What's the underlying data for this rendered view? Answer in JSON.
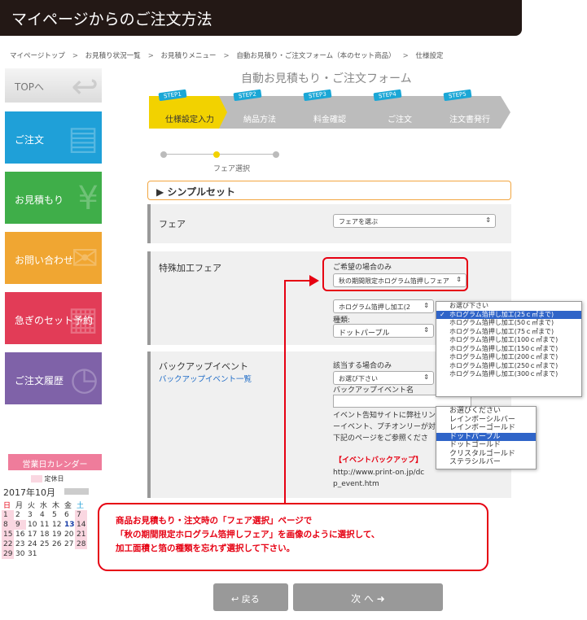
{
  "header": {
    "title": "マイページからのご注文方法"
  },
  "breadcrumb": [
    "マイページトップ",
    "お見積り状況一覧",
    "お見積りメニュー",
    "自動お見積り・ご注文フォーム（本のセット商品）",
    "仕様設定"
  ],
  "breadcrumb_sep": ">",
  "sidebar": {
    "top_label": "TOPへ",
    "items": [
      {
        "label": "ご注文",
        "color": "#1fa0d8"
      },
      {
        "label": "お見積もり",
        "color": "#3fae49"
      },
      {
        "label": "お問い合わせ",
        "color": "#f0a632"
      },
      {
        "label": "急ぎのセット予約",
        "color": "#e23c57"
      },
      {
        "label": "ご注文履歴",
        "color": "#7f62a8"
      }
    ]
  },
  "form_title": "自動お見積もり・ご注文フォーム",
  "steps": [
    {
      "tag": "STEP1",
      "label": "仕様設定入力"
    },
    {
      "tag": "STEP2",
      "label": "納品方法"
    },
    {
      "tag": "STEP3",
      "label": "料金確認"
    },
    {
      "tag": "STEP4",
      "label": "ご注文"
    },
    {
      "tag": "STEP5",
      "label": "注文書発行"
    }
  ],
  "progress_label": "フェア選択",
  "section_title": "シンプルセット",
  "fair": {
    "label": "フェア",
    "select_value": "フェアを選ぶ"
  },
  "special": {
    "label": "特殊加工フェア",
    "hint": "ご希望の場合のみ",
    "select_value": "秋の期間限定ホログラム箔押しフェア",
    "sub_select": "ホログラム箔押し加工(2",
    "kind_label": "種類:",
    "kind_value": "ドットパープル"
  },
  "backup": {
    "label": "バックアップイベント",
    "link": "バックアップイベント一覧",
    "hint": "該当する場合のみ",
    "select_value": "お選び下さい",
    "name_label": "バックアップイベント名",
    "body_lines": [
      "イベント告知サイトに弊社リン",
      "ーイベント、プチオンリーが対",
      "下記のページをご参照くださ"
    ],
    "event_heading": "【イベントバックアップ】",
    "url_lines": [
      "http://www.print-on.jp/dc",
      "p_event.htm"
    ]
  },
  "area_dropdown": {
    "items": [
      "お選び下さい",
      "ホログラム箔押し加工(25ｃ㎡まで)",
      "ホログラム箔押し加工(50ｃ㎡まで)",
      "ホログラム箔押し加工(75ｃ㎡まで)",
      "ホログラム箔押し加工(100ｃ㎡まで)",
      "ホログラム箔押し加工(150ｃ㎡まで)",
      "ホログラム箔押し加工(200ｃ㎡まで)",
      "ホログラム箔押し加工(250ｃ㎡まで)",
      "ホログラム箔押し加工(300ｃ㎡まで)"
    ],
    "selected_index": 1,
    "check": "✓"
  },
  "kind_dropdown": {
    "items": [
      "お選びください",
      "レインボーシルバー",
      "レインボーゴールド",
      "ドットパープル",
      "ドットゴールド",
      "クリスタルゴールド",
      "ステラシルバー"
    ],
    "selected_index": 3
  },
  "calendar": {
    "title": "営業日カレンダー",
    "legend": "定休日",
    "month": "2017年10月",
    "weekdays": [
      "日",
      "月",
      "火",
      "水",
      "木",
      "金",
      "土"
    ],
    "weeks": [
      [
        "1",
        "2",
        "3",
        "4",
        "5",
        "6",
        "7"
      ],
      [
        "8",
        "9",
        "10",
        "11",
        "12",
        "13",
        "14"
      ],
      [
        "15",
        "16",
        "17",
        "18",
        "19",
        "20",
        "21"
      ],
      [
        "22",
        "23",
        "24",
        "25",
        "26",
        "27",
        "28"
      ],
      [
        "29",
        "30",
        "31",
        "",
        "",
        "",
        ""
      ]
    ]
  },
  "note_lines": [
    "商品お見積もり・注文時の「フェア選択」ページで",
    "「秋の期間限定ホログラム箔押しフェア」を画像のように選択して、",
    "加工面積と箔の種類を忘れず選択して下さい。"
  ],
  "nav": {
    "back": "戻る",
    "next": "次 へ"
  }
}
